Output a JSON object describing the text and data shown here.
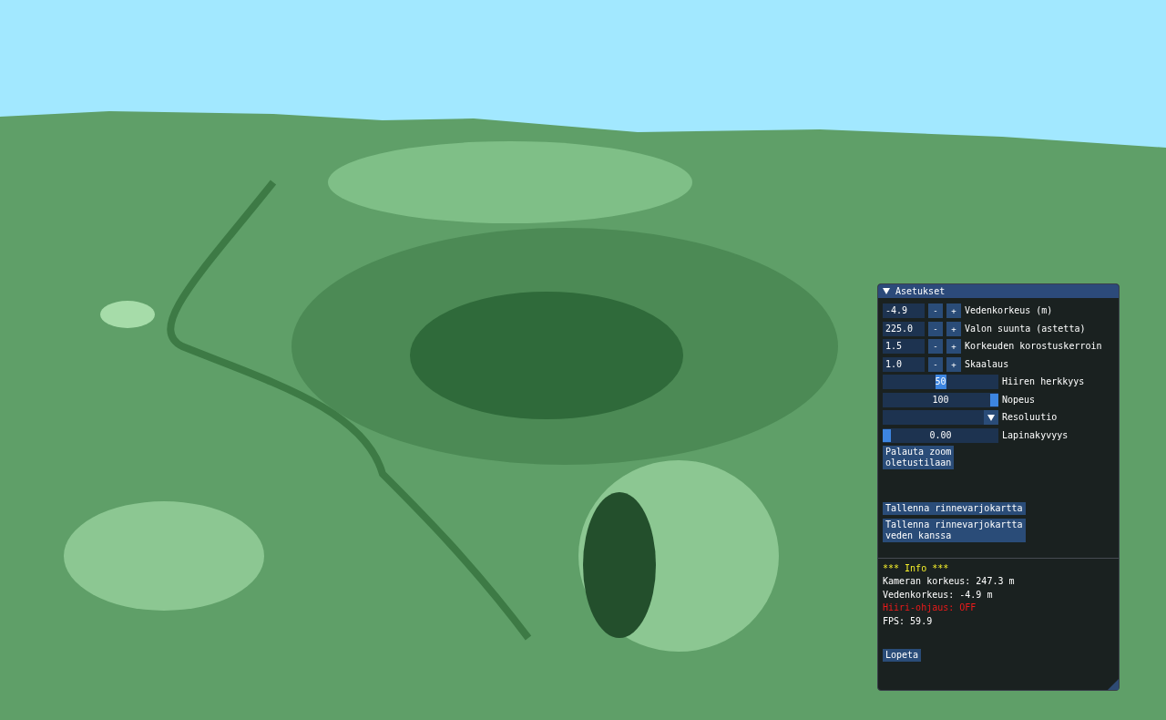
{
  "window": {
    "title": "Asetukset",
    "expanded": true
  },
  "steppers": [
    {
      "value": "-4.9",
      "minus": "-",
      "plus": "+",
      "label": "Vedenkorkeus (m)"
    },
    {
      "value": "225.0",
      "minus": "-",
      "plus": "+",
      "label": "Valon suunta (astetta)"
    },
    {
      "value": "1.5",
      "minus": "-",
      "plus": "+",
      "label": "Korkeuden korostuskerroin"
    },
    {
      "value": "1.0",
      "minus": "-",
      "plus": "+",
      "label": "Skaalaus"
    }
  ],
  "controls": [
    {
      "kind": "drag",
      "value": "50",
      "text_selected": true,
      "label": "Hiiren herkkyys"
    },
    {
      "kind": "slider",
      "value": "100",
      "level": 1,
      "label": "Nopeus"
    },
    {
      "kind": "dropdown",
      "label": "Resoluutio"
    },
    {
      "kind": "slider",
      "value": "0.00",
      "level": 0,
      "label": "Lapinakyvyys"
    }
  ],
  "reset_button": "Palauta zoom\noletustilaan",
  "save_buttons": [
    "Tallenna rinnevarjokartta",
    "Tallenna rinnevarjokartta\nveden kanssa"
  ],
  "info": [
    {
      "kind": "heading",
      "text": "*** Info ***"
    },
    {
      "kind": "normal",
      "text": "Kameran korkeus: 247.3 m"
    },
    {
      "kind": "normal",
      "text": "Vedenkorkeus: -4.9 m"
    },
    {
      "kind": "alert",
      "text": "Hiiri-ohjaus: OFF"
    },
    {
      "kind": "normal",
      "text": "FPS: 59.9"
    }
  ],
  "quit_button": "Lopeta"
}
